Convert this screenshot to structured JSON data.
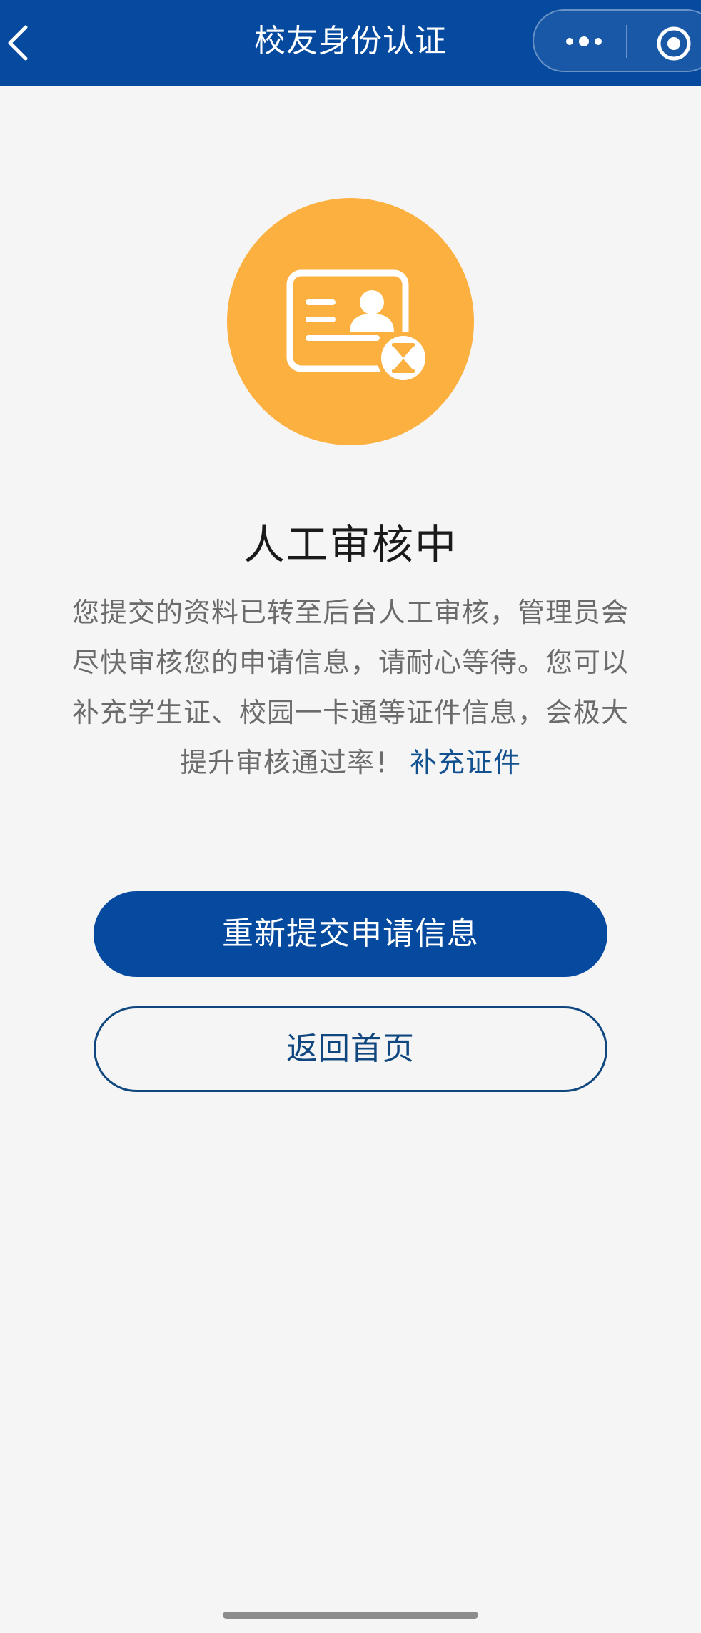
{
  "navbar": {
    "title": "校友身份认证",
    "back_icon": "chevron-left-icon",
    "more_icon": "more-dots-icon",
    "close_icon": "target-close-icon",
    "background_color": "#054a9f"
  },
  "status": {
    "icon": "id-card-pending-icon",
    "icon_color": "#fbb040",
    "title": "人工审核中",
    "description": "您提交的资料已转至后台人工审核，管理员会尽快审核您的申请信息，请耐心等待。您可以补充学生证、校园一卡通等证件信息，会极大提升审核通过率！",
    "supplement_link": "补充证件",
    "link_color": "#12518f"
  },
  "actions": {
    "resubmit_label": "重新提交申请信息",
    "home_label": "返回首页"
  }
}
